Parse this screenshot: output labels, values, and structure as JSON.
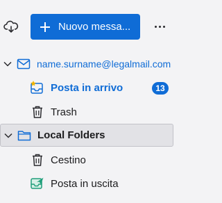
{
  "toolbar": {
    "sync_icon": "cloud-sync-icon",
    "new_message_label": "Nuovo messa...",
    "more_icon": "more-horizontal-icon"
  },
  "folders": {
    "account": {
      "label": "name.surname@legalmail.com",
      "icon": "mail-account-icon",
      "expanded": true
    },
    "inbox": {
      "label": "Posta in arrivo",
      "icon": "inbox-icon",
      "unread_count": "13"
    },
    "trash": {
      "label": "Trash",
      "icon": "trash-icon"
    },
    "local": {
      "label": "Local Folders",
      "icon": "folder-icon",
      "expanded": true,
      "selected": true
    },
    "cestino": {
      "label": "Cestino",
      "icon": "trash-icon"
    },
    "outbox": {
      "label": "Posta in uscita",
      "icon": "outbox-icon"
    }
  },
  "colors": {
    "accent": "#0f6cd6",
    "background": "#f3f3f5",
    "selected_row": "#e2e2e6",
    "outbox_icon": "#1f9e7a",
    "new_mail_star": "#f0b400"
  }
}
